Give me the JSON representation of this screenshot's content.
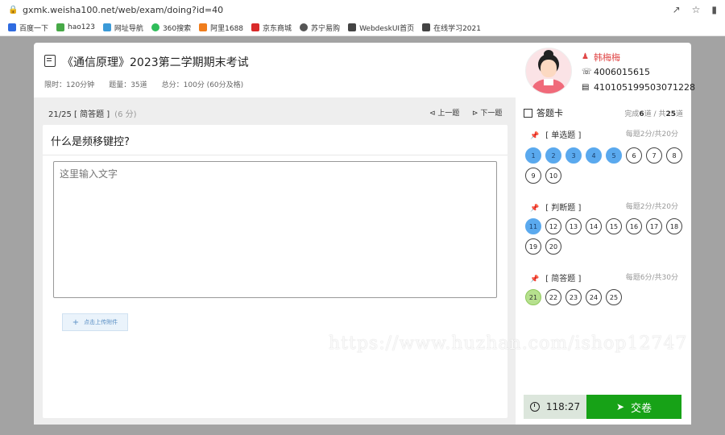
{
  "browser": {
    "url": "gxmk.weisha100.net/web/exam/doing?id=40",
    "bookmarks": [
      "百度一下",
      "hao123",
      "网址导航",
      "360搜索",
      "阿里1688",
      "京东商城",
      "苏宁易购",
      "WebdeskUI首页",
      "在线学习2021"
    ],
    "bookmark_colors": [
      "#2f6be0",
      "#47a947",
      "#3b9ad8",
      "#2fbd5a",
      "#f07d1c",
      "#d92a2a",
      "#555555",
      "#444444",
      "#444444"
    ]
  },
  "exam": {
    "title": "《通信原理》2023第二学期期末考试",
    "time_limit": "限时：120分钟",
    "question_count": "题量：35道",
    "total_score": "总分：100分 (60分及格)"
  },
  "user": {
    "name": "韩梅梅",
    "phone": "4006015615",
    "id_number": "410105199503071228"
  },
  "question": {
    "header": "21/25 [ 简答题 ]",
    "score": "(6 分)",
    "prev_label": "上一题",
    "next_label": "下一题",
    "text": "什么是频移键控?",
    "answer_placeholder": "这里输入文字",
    "upload_label": "点击上传附件"
  },
  "answer_card": {
    "title": "答题卡",
    "progress_prefix": "完成",
    "completed": "6",
    "progress_mid": "道 / 共",
    "total": "25",
    "progress_suffix": "道",
    "sections": [
      {
        "title": "[ 单选题 ]",
        "note": "每题2分/共20分"
      },
      {
        "title": "[ 判断题 ]",
        "note": "每题2分/共20分"
      },
      {
        "title": "[ 简答题 ]",
        "note": "每题6分/共30分"
      }
    ]
  },
  "timer": "118:27",
  "submit_label": "交卷",
  "watermark": "https://www.huzhan.com/ishop12747"
}
